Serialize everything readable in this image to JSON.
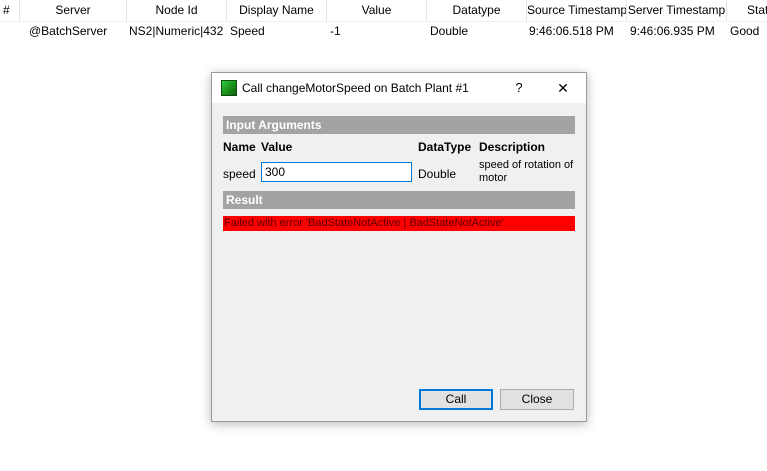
{
  "table": {
    "columns": [
      "#",
      "Server",
      "Node Id",
      "Display Name",
      "Value",
      "Datatype",
      "Source Timestamp",
      "Server Timestamp",
      "Status"
    ],
    "rows": [
      {
        "server": "@BatchServer",
        "node_id": "NS2|Numeric|432",
        "display_name": "Speed",
        "value": "-1",
        "datatype": "Double",
        "source_timestamp": "9:46:06.518 PM",
        "server_timestamp": "9:46:06.935 PM",
        "status": "Good"
      }
    ]
  },
  "dialog": {
    "title": "Call changeMotorSpeed on Batch Plant #1",
    "help_label": "?",
    "close_label": "✕",
    "input_section": "Input Arguments",
    "headers": {
      "name": "Name",
      "value": "Value",
      "datatype": "DataType",
      "description": "Description"
    },
    "arguments": [
      {
        "name": "speed",
        "value": "300",
        "datatype": "Double",
        "description": "speed of rotation of motor"
      }
    ],
    "result_section": "Result",
    "result_error": "Failed with error 'BadStateNotActive | BadStateNotActive'",
    "buttons": {
      "call": "Call",
      "close": "Close"
    }
  },
  "colors": {
    "section_bar": "#a3a3a3",
    "error": "#ff0000",
    "focus_border": "#0078d7"
  },
  "icons": {
    "app": "green-square-icon",
    "help": "help-icon",
    "close": "close-icon"
  }
}
